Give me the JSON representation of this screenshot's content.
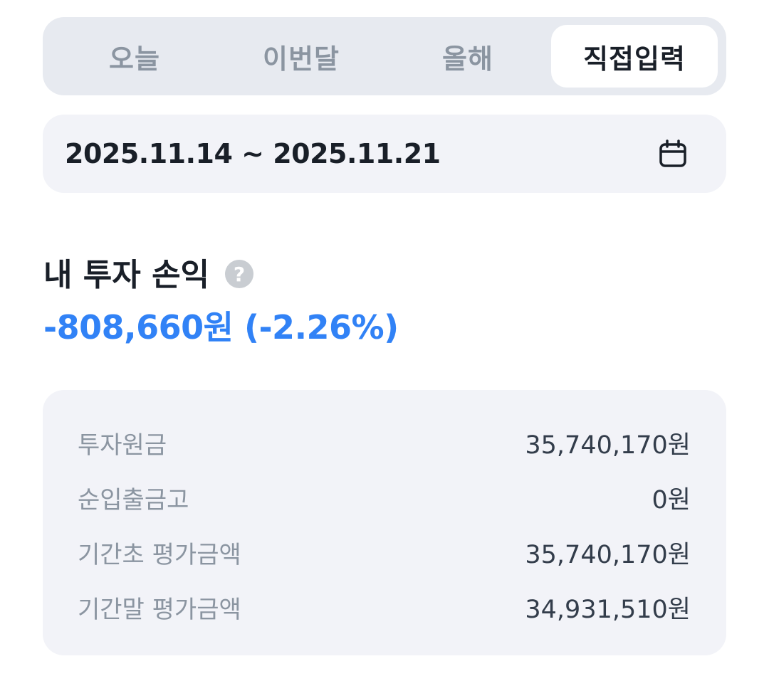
{
  "tabs": [
    {
      "label": "오늘",
      "active": false
    },
    {
      "label": "이번달",
      "active": false
    },
    {
      "label": "올해",
      "active": false
    },
    {
      "label": "직접입력",
      "active": true
    }
  ],
  "date_range": {
    "text": "2025.11.14 ~ 2025.11.21",
    "icon": "calendar-icon"
  },
  "profit": {
    "title": "내 투자 손익",
    "help_icon": "question-mark-icon",
    "help_glyph": "?",
    "value": "-808,660원 (-2.26%)",
    "color": "#3182f6"
  },
  "summary": [
    {
      "label": "투자원금",
      "value": "35,740,170원"
    },
    {
      "label": "순입출금고",
      "value": "0원"
    },
    {
      "label": "기간초 평가금액",
      "value": "35,740,170원"
    },
    {
      "label": "기간말 평가금액",
      "value": "34,931,510원"
    }
  ],
  "colors": {
    "accent_blue": "#3182f6",
    "text_primary": "#191f28",
    "text_secondary": "#8b95a1",
    "card_bg": "#f2f3f8",
    "segment_bg": "#e7eaf0"
  }
}
